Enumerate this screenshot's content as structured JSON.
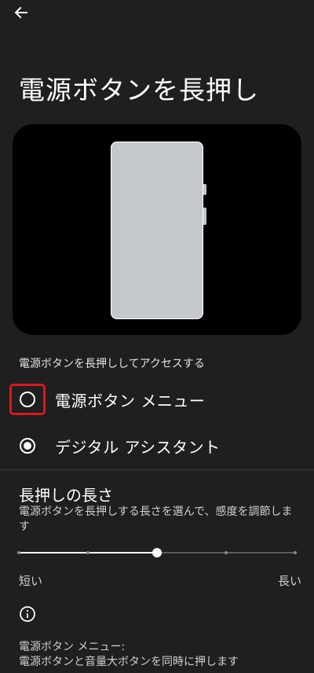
{
  "header": {
    "back_icon": "arrow-left-icon"
  },
  "page": {
    "title": "電源ボタンを長押し"
  },
  "preview": {
    "icon": "phone-illustration"
  },
  "access_section": {
    "label": "電源ボタンを長押ししてアクセスする",
    "options": [
      {
        "label": "電源ボタン メニュー",
        "selected": false,
        "highlighted": true
      },
      {
        "label": "デジタル アシスタント",
        "selected": true,
        "highlighted": false
      }
    ]
  },
  "press_length": {
    "title": "長押しの長さ",
    "description": "電源ボタンを長押しする長さを選んで、感度を調節します",
    "slider": {
      "steps": 5,
      "value_index": 2
    },
    "min_label": "短い",
    "max_label": "長い"
  },
  "info": {
    "icon": "info-icon",
    "text_line1": "電源ボタン メニュー:",
    "text_line2": "電源ボタンと音量大ボタンを同時に押します"
  },
  "colors": {
    "background": "#1f1f1f",
    "highlight": "#e0161b",
    "phone": "#c4c7cc"
  }
}
